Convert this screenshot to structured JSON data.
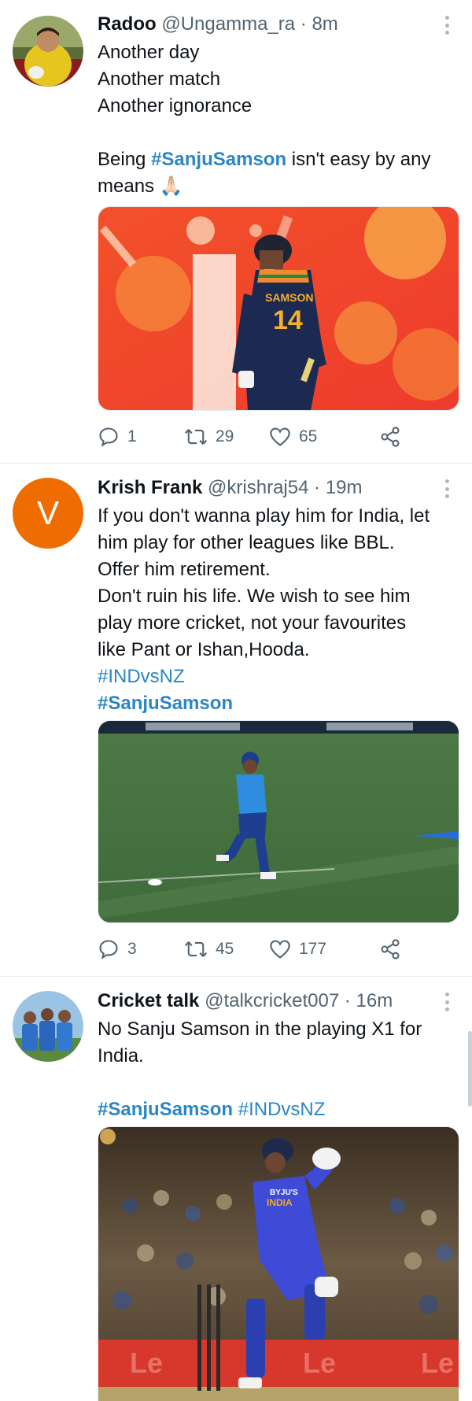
{
  "tweets": [
    {
      "name": "Radoo",
      "handle": "@Ungamma_ra",
      "separator": "·",
      "time": "8m",
      "lines": [
        "Another day",
        "Another match",
        "Another ignorance",
        "",
        "Being ",
        "means 🙏🏻"
      ],
      "hashtag_inline": "#SanjuSamson",
      "line5_suffix": " isn't easy by any",
      "image_caption_jersey": "SAMSON",
      "image_caption_number": "14",
      "replies": "1",
      "retweets": "29",
      "likes": "65"
    },
    {
      "name": "Krish Frank",
      "handle": "@krishraj54",
      "separator": "·",
      "time": "19m",
      "avatar_letter": "V",
      "lines": [
        "If you don't wanna play him for India, let",
        "him play for other leagues like BBL.",
        "Offer him retirement.",
        "Don't ruin his life. We wish to see him",
        "play more cricket, not your favourites",
        "like Pant or Ishan,Hooda."
      ],
      "hashtag_1": "#INDvsNZ",
      "hashtag_2": "#SanjuSamson",
      "replies": "3",
      "retweets": "45",
      "likes": "177"
    },
    {
      "name": "Cricket talk",
      "handle": "@talkcricket007",
      "separator": "·",
      "time": "16m",
      "lines": [
        "No Sanju Samson in the playing X1 for",
        "India."
      ],
      "hashtag_1": "#SanjuSamson",
      "hashtag_2": "#INDvsNZ",
      "image_caption_jersey": "INDIA",
      "image_caption_sponsor": "BYJU'S"
    }
  ],
  "icons": [
    "reply-icon",
    "retweet-icon",
    "like-icon",
    "share-icon",
    "more-icon"
  ],
  "colors": {
    "hashtag": "#2b86c5",
    "secondary_text": "#536471",
    "avatar_v": "#ef6c00"
  }
}
